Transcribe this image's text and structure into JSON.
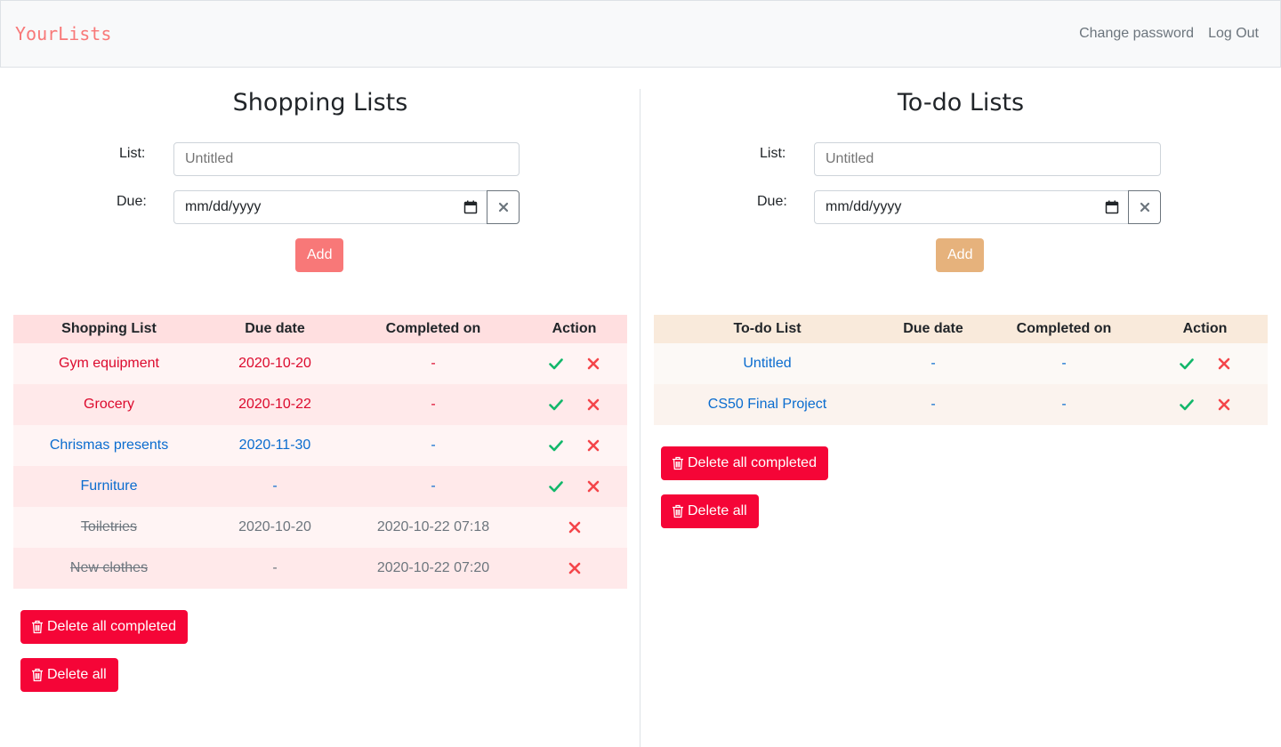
{
  "app": {
    "brand": "YourLists",
    "nav": {
      "change_password": "Change password",
      "logout": "Log Out"
    }
  },
  "colors": {
    "brand": "#f87878",
    "shopping_add": "#f87878",
    "todo_add": "#e6b27c",
    "danger": "#f50537",
    "check": "#12b76a",
    "cross": "#f4454a",
    "link_red": "#dc0a2d",
    "link_blue": "#0a6ccf",
    "muted": "#6c757d"
  },
  "shopping": {
    "title": "Shopping Lists",
    "form": {
      "list_label": "List:",
      "list_placeholder": "Untitled",
      "due_label": "Due:",
      "due_placeholder": "mm/dd/yyyy",
      "add_label": "Add"
    },
    "table": {
      "headers": [
        "Shopping List",
        "Due date",
        "Completed on",
        "Action"
      ],
      "rows": [
        {
          "name": "Gym equipment",
          "due": "2020-10-20",
          "completed": "-",
          "status": "overdue"
        },
        {
          "name": "Grocery",
          "due": "2020-10-22",
          "completed": "-",
          "status": "overdue"
        },
        {
          "name": "Chrismas presents",
          "due": "2020-11-30",
          "completed": "-",
          "status": "pending"
        },
        {
          "name": "Furniture",
          "due": "-",
          "completed": "-",
          "status": "pending"
        },
        {
          "name": "Toiletries",
          "due": "2020-10-20",
          "completed": "2020-10-22 07:18",
          "status": "done"
        },
        {
          "name": "New clothes",
          "due": "-",
          "completed": "2020-10-22 07:20",
          "status": "done"
        }
      ]
    },
    "delete_completed": "Delete all completed",
    "delete_all": "Delete all"
  },
  "todo": {
    "title": "To-do Lists",
    "form": {
      "list_label": "List:",
      "list_placeholder": "Untitled",
      "due_label": "Due:",
      "due_placeholder": "mm/dd/yyyy",
      "add_label": "Add"
    },
    "table": {
      "headers": [
        "To-do List",
        "Due date",
        "Completed on",
        "Action"
      ],
      "rows": [
        {
          "name": "Untitled",
          "due": "-",
          "completed": "-",
          "status": "pending"
        },
        {
          "name": "CS50 Final Project",
          "due": "-",
          "completed": "-",
          "status": "pending"
        }
      ]
    },
    "delete_completed": "Delete all completed",
    "delete_all": "Delete all"
  }
}
